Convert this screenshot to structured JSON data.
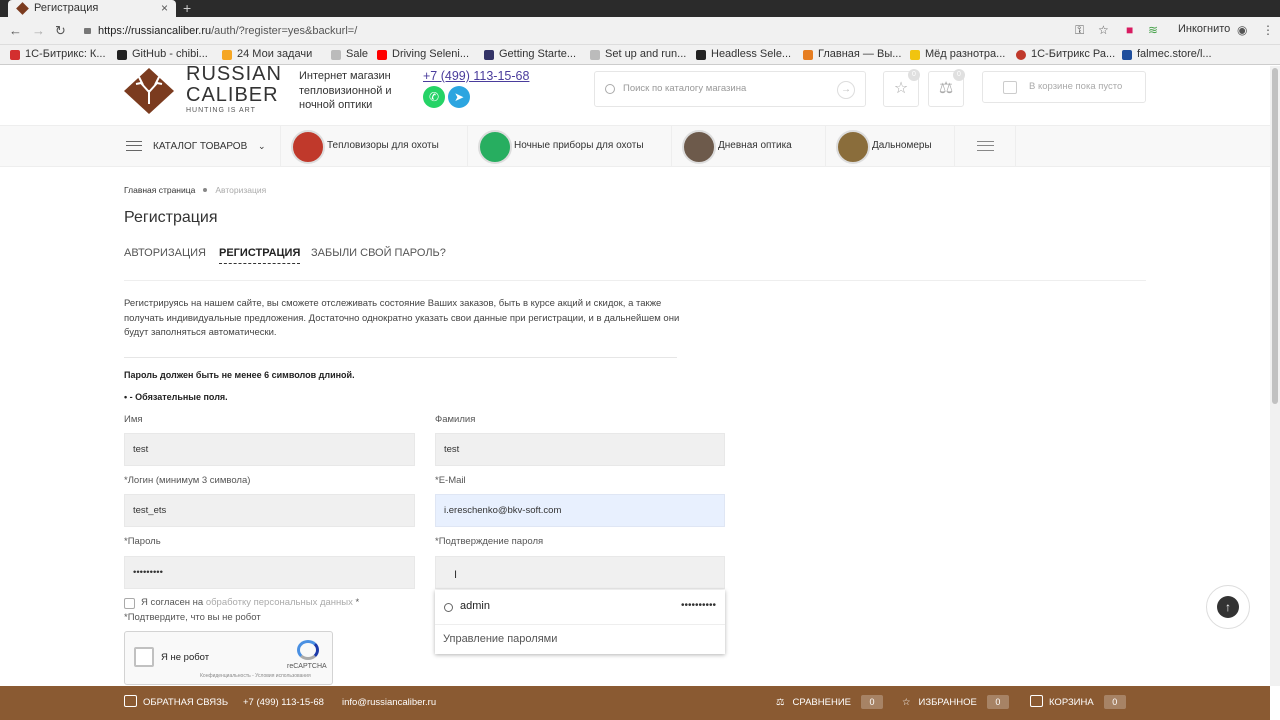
{
  "browser": {
    "tab_title": "Регистрация",
    "new_tab": "+",
    "url_host": "https://russiancaliber.ru",
    "url_path": "/auth/?register=yes&backurl=/",
    "incognito_label": "Инкогнито",
    "bookmarks": [
      {
        "label": "1С-Битрикс: К...",
        "color": "#d32f2f"
      },
      {
        "label": "GitHub - chibi...",
        "color": "#222222"
      },
      {
        "label": "24 Мои задачи",
        "color": "#f5a623"
      },
      {
        "label": "Sale",
        "color": "#999999"
      },
      {
        "label": "Driving Seleni...",
        "color": "#ff0000"
      },
      {
        "label": "Getting Starte...",
        "color": "#333366"
      },
      {
        "label": "Set up and run...",
        "color": "#999999"
      },
      {
        "label": "Headless Sele...",
        "color": "#222222"
      },
      {
        "label": "Главная — Вы...",
        "color": "#e67e22"
      },
      {
        "label": "Мёд разнотра...",
        "color": "#f1c40f"
      },
      {
        "label": "1С-Битрикс Ра...",
        "color": "#c0392b"
      },
      {
        "label": "falmec.store/l...",
        "color": "#1f4e9c"
      }
    ]
  },
  "header": {
    "logo_line1": "RUSSIAN",
    "logo_line2": "CALIBER",
    "logo_sub": "HUNTING IS ART",
    "slogan": "Интернет магазин тепловизионной и ночной оптики",
    "phone": "+7 (499) 113-15-68",
    "search_placeholder": "Поиск по каталогу магазина",
    "favorites_count": "0",
    "compare_count": "0",
    "cart_text": "В корзине пока пусто"
  },
  "nav": {
    "catalog": "КАТАЛОГ ТОВАРОВ",
    "items": [
      {
        "label": "Тепловизоры для охоты",
        "color": "#c0392b"
      },
      {
        "label": "Ночные приборы для охоты",
        "color": "#27ae60"
      },
      {
        "label": "Дневная оптика",
        "color": "#6d5a4b"
      },
      {
        "label": "Дальномеры",
        "color": "#8a6d3b"
      }
    ]
  },
  "breadcrumbs": {
    "home": "Главная страница",
    "current": "Авторизация"
  },
  "page_title": "Регистрация",
  "tabs": {
    "login": "АВТОРИЗАЦИЯ",
    "register": "РЕГИСТРАЦИЯ",
    "forgot": "ЗАБЫЛИ СВОЙ ПАРОЛЬ?"
  },
  "intro": "Регистрируясь на нашем сайте, вы сможете отслеживать состояние Ваших заказов, быть в курсе акций и скидок, а также получать индивидуальные предложения. Достаточно однократно указать свои данные при регистрации, и в дальнейшем они будут заполняться автоматически.",
  "notes": {
    "password_rule": "Пароль должен быть не менее 6 символов длиной.",
    "required": "• - Обязательные поля."
  },
  "form": {
    "name_label": "Имя",
    "name_value": "test",
    "surname_label": "Фамилия",
    "surname_value": "test",
    "login_label": "*Логин (минимум 3 символа)",
    "login_value": "test_ets",
    "email_label": "*E-Mail",
    "email_value": "i.ereschenko@bkv-soft.com",
    "password_label": "*Пароль",
    "password_value": "•••••••••",
    "confirm_label": "*Подтверждение пароля",
    "confirm_value": "",
    "agree_prefix": "Я согласен на ",
    "agree_link": "обработку персональных данных",
    "agree_suffix": " *",
    "robot_question": "*Подтвердите, что вы не робот",
    "recaptcha_label": "Я не робот",
    "recaptcha_brand": "reCAPTCHA",
    "recaptcha_terms": "Конфиденциальность - Условия использования"
  },
  "password_popup": {
    "user": "admin",
    "password": "••••••••••",
    "manage": "Управление паролями"
  },
  "footer": {
    "feedback": "ОБРАТНАЯ СВЯЗЬ",
    "phone": "+7 (499) 113-15-68",
    "email": "info@russiancaliber.ru",
    "compare": "СРАВНЕНИЕ",
    "compare_count": "0",
    "favorites": "ИЗБРАННОЕ",
    "favorites_count": "0",
    "cart": "КОРЗИНА",
    "cart_count": "0"
  },
  "colors": {
    "footer_bg": "#8a5a32",
    "brand_dark": "#7b3b1f",
    "link": "#4a3c9c",
    "autofill": "#e8f0fe"
  }
}
